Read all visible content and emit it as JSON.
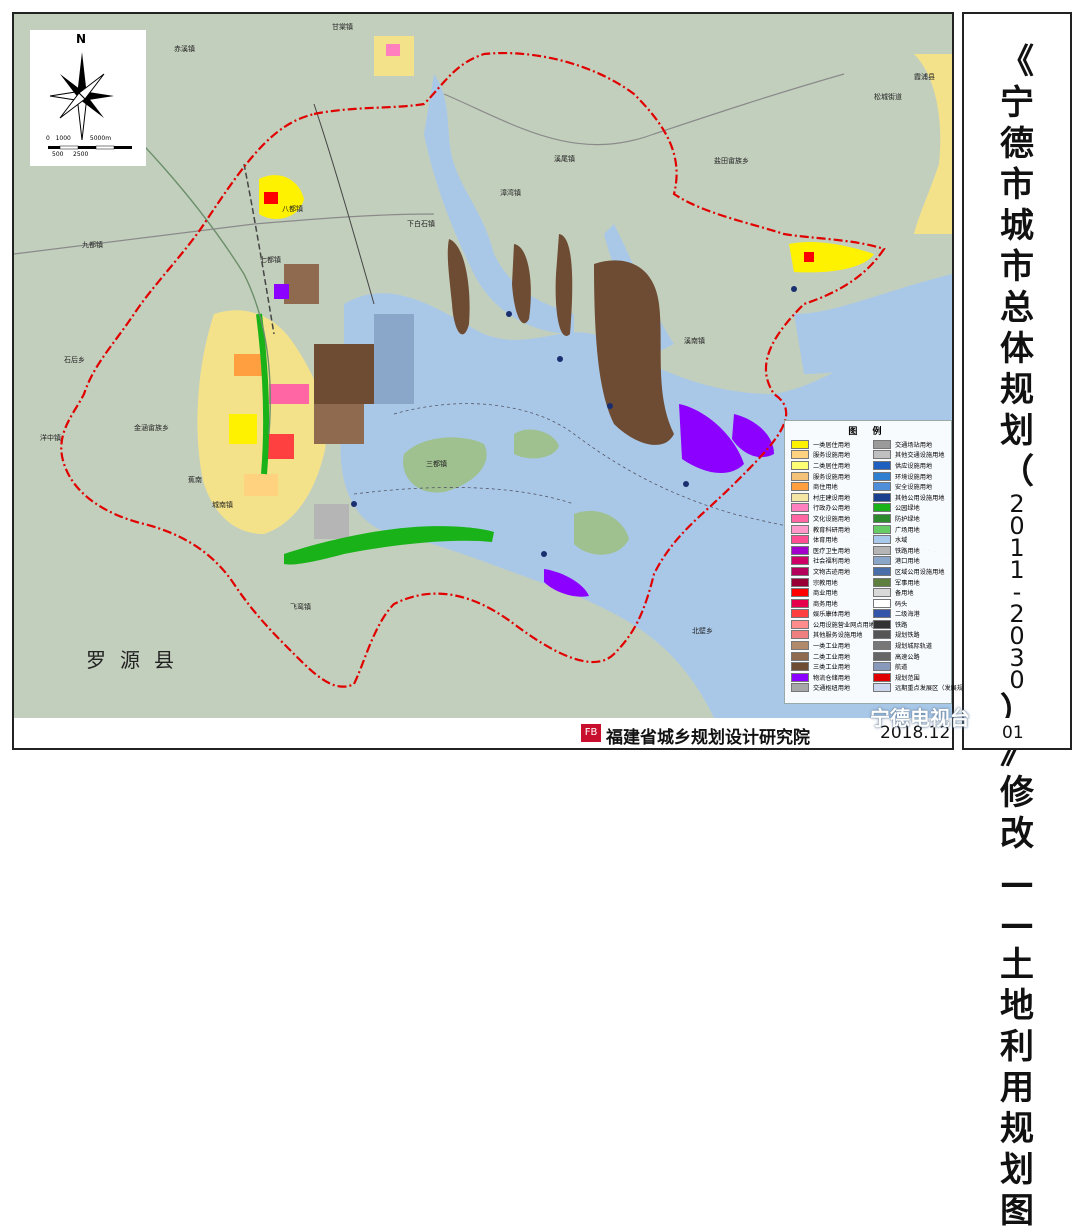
{
  "title_chars": [
    "《",
    "宁",
    "德",
    "市",
    "城",
    "市",
    "总",
    "体",
    "规",
    "划",
    "（",
    "2",
    "0",
    "1",
    "1",
    "-",
    "2",
    "0",
    "3",
    "0",
    "）",
    "》",
    "修",
    "改"
  ],
  "subtitle_chars": [
    "—",
    "—",
    "土",
    "地",
    "利",
    "用",
    "规",
    "划",
    "图"
  ],
  "institute": "福建省城乡规划设计研究院",
  "institute_logo": "FB",
  "date": "2018.12",
  "sheet_no": "01",
  "watermark": "宁德电视台",
  "compass": {
    "north": "N",
    "scale_top": [
      "0",
      "1000",
      "5000m"
    ],
    "scale_bottom": [
      "500",
      "2500"
    ]
  },
  "county_label": "罗源县",
  "places": [
    {
      "name": "甘棠镇",
      "id": "gantang"
    },
    {
      "name": "赤溪镇",
      "id": "chixi"
    },
    {
      "name": "八都镇",
      "id": "badu"
    },
    {
      "name": "七都镇",
      "id": "qidu"
    },
    {
      "name": "九都镇",
      "id": "jiudu"
    },
    {
      "name": "石后乡",
      "id": "shihou"
    },
    {
      "name": "洋中镇",
      "id": "yangzhong"
    },
    {
      "name": "金涵畲族乡",
      "id": "jinhan"
    },
    {
      "name": "蕉南",
      "id": "jiaonan"
    },
    {
      "name": "城南镇",
      "id": "chengnan"
    },
    {
      "name": "飞鸾镇",
      "id": "feiluan"
    },
    {
      "name": "下白石镇",
      "id": "xiabaishi"
    },
    {
      "name": "溪尾镇",
      "id": "xiwei"
    },
    {
      "name": "盐田畲族乡",
      "id": "yantian"
    },
    {
      "name": "漳湾镇",
      "id": "zhangwan"
    },
    {
      "name": "溪南镇",
      "id": "xinan"
    },
    {
      "name": "三都镇",
      "id": "sandu"
    },
    {
      "name": "北壁乡",
      "id": "beibi"
    },
    {
      "name": "松城街道",
      "id": "songcheng"
    },
    {
      "name": "霞浦县",
      "id": "xiapu"
    }
  ],
  "legend": {
    "title": "图 例",
    "left": [
      {
        "label": "一类居住用地",
        "color": "#fff200"
      },
      {
        "label": "服务设施用地",
        "color": "#ffd27f"
      },
      {
        "label": "二类居住用地",
        "color": "#ffff73"
      },
      {
        "label": "服务设施用地",
        "color": "#f5c27a"
      },
      {
        "label": "商住用地",
        "color": "#ff9f3f"
      },
      {
        "label": "村庄建设用地",
        "color": "#f4e6a4"
      },
      {
        "label": "行政办公用地",
        "color": "#ff7fbf"
      },
      {
        "label": "文化设施用地",
        "color": "#ff66a3"
      },
      {
        "label": "教育科研用地",
        "color": "#ff99cc"
      },
      {
        "label": "体育用地",
        "color": "#ff4d94"
      },
      {
        "label": "医疗卫生用地",
        "color": "#a300cc"
      },
      {
        "label": "社会福利用地",
        "color": "#cc0066"
      },
      {
        "label": "文物古迹用地",
        "color": "#b3005a"
      },
      {
        "label": "宗教用地",
        "color": "#990033"
      },
      {
        "label": "商业用地",
        "color": "#ff0000"
      },
      {
        "label": "商务用地",
        "color": "#e6004c"
      },
      {
        "label": "娱乐康体用地",
        "color": "#ff4040"
      },
      {
        "label": "公用设施营业网点用地",
        "color": "#ff8c8c"
      },
      {
        "label": "其他服务设施用地",
        "color": "#f08080"
      },
      {
        "label": "一类工业用地",
        "color": "#b08a6a"
      },
      {
        "label": "二类工业用地",
        "color": "#8f6a4e"
      },
      {
        "label": "三类工业用地",
        "color": "#6e4b33"
      },
      {
        "label": "物流仓储用地",
        "color": "#8c00ff"
      },
      {
        "label": "交通枢纽用地",
        "color": "#a6a6a6"
      }
    ],
    "right": [
      {
        "label": "交通场站用地",
        "color": "#9a9a9a"
      },
      {
        "label": "其他交通设施用地",
        "color": "#c0c0c0"
      },
      {
        "label": "供应设施用地",
        "color": "#1f5fbf"
      },
      {
        "label": "环境设施用地",
        "color": "#2f7fd0"
      },
      {
        "label": "安全设施用地",
        "color": "#4f8fd9"
      },
      {
        "label": "其他公用设施用地",
        "color": "#1a3f8f"
      },
      {
        "label": "公园绿地",
        "color": "#19b319"
      },
      {
        "label": "防护绿地",
        "color": "#2d8a2d"
      },
      {
        "label": "广场用地",
        "color": "#66cc66"
      },
      {
        "label": "水域",
        "color": "#a8c8ec"
      },
      {
        "label": "铁路用地",
        "color": "#b5b5b5"
      },
      {
        "label": "港口用地",
        "color": "#8aa6c8"
      },
      {
        "label": "区域公用设施用地",
        "color": "#4a6fa8"
      },
      {
        "label": "军事用地",
        "color": "#5f7f3f"
      },
      {
        "label": "备用地",
        "color": "#d9d9d9"
      },
      {
        "label": "码头",
        "color": "#ffffff"
      },
      {
        "label": "二级海港",
        "color": "#3355aa"
      },
      {
        "label": "铁路",
        "color": "#333333"
      },
      {
        "label": "规划铁路",
        "color": "#555555"
      },
      {
        "label": "规划城际轨道",
        "color": "#777777"
      },
      {
        "label": "高速公路",
        "color": "#666666"
      },
      {
        "label": "航道",
        "color": "#8899bb"
      },
      {
        "label": "规划范围",
        "color": "#e00000"
      },
      {
        "label": "远期重点发展区（发展规模待定）",
        "color": "#c9d6ee"
      }
    ]
  }
}
